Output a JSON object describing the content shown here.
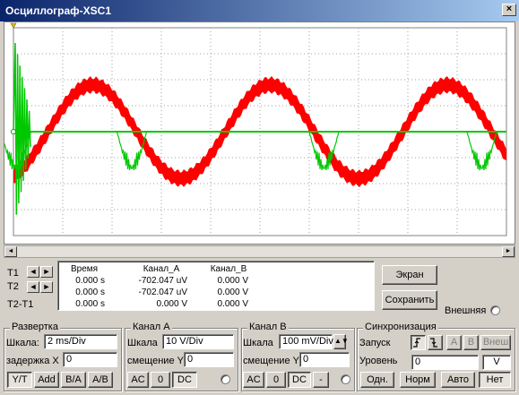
{
  "window": {
    "title": "Осциллограф-XSC1",
    "close_label": "×"
  },
  "colors": {
    "channel_a": "#ff0000",
    "channel_b": "#00c800",
    "grid": "#808080",
    "screen_bg": "#ffffff"
  },
  "chart_data": {
    "type": "line",
    "title": "",
    "xlabel": "",
    "ylabel": "",
    "grid": true,
    "x_divisions": 10,
    "y_divisions": 8,
    "series": [
      {
        "kind": "sine band",
        "amplitude_div": 1.8,
        "period_div": 3.6,
        "phase_div": 0.7,
        "band_div": 0.55
      },
      {
        "kind": "baseline with bursts",
        "burst_centers_div": [
          0.05,
          2.4,
          6.3,
          9.5
        ],
        "burst_amp_div": 1.6,
        "center_div": 4.0
      }
    ]
  },
  "cursors": {
    "t1_label": "T1",
    "t2_label": "T2",
    "diff_label": "T2-T1",
    "left_arrow": "◄",
    "right_arrow": "►"
  },
  "measurements": {
    "headers": [
      "Время",
      "Канал_A",
      "Канал_B"
    ],
    "rows": [
      [
        "0.000 s",
        "-702.047 uV",
        "0.000 V"
      ],
      [
        "0.000 s",
        "-702.047 uV",
        "0.000 V"
      ],
      [
        "0.000 s",
        "0.000 V",
        "0.000 V"
      ]
    ]
  },
  "side": {
    "screen_btn": "Экран",
    "save_btn": "Сохранить",
    "ext_label": "Внешняя"
  },
  "timebase": {
    "title": "Развертка",
    "scale_label": "Шкала:",
    "scale_value": "2 ms/Div",
    "delay_label": "задержка X",
    "delay_value": "0",
    "modes": [
      "Y/T",
      "Add",
      "B/A",
      "A/B"
    ]
  },
  "channel_a": {
    "title": "Канал A",
    "scale_label": "Шкала",
    "scale_value": "10  V/Div",
    "offset_label": "смещение Y",
    "offset_value": "0",
    "coupling": [
      "AC",
      "0",
      "DC"
    ]
  },
  "channel_b": {
    "title": "Канал В",
    "scale_label": "Шкала",
    "scale_value": "100 mV/Div",
    "offset_label": "смещение Y",
    "offset_value": "0",
    "coupling": [
      "AC",
      "0",
      "DC",
      "-"
    ]
  },
  "trigger": {
    "title": "Синхронизация",
    "edge_label": "Запуск",
    "source_buttons": [
      "A",
      "B",
      "Внеш"
    ],
    "level_label": "Уровень",
    "level_value": "0",
    "level_unit": "V",
    "modes": [
      "Одн.",
      "Норм",
      "Авто",
      "Нет"
    ]
  }
}
